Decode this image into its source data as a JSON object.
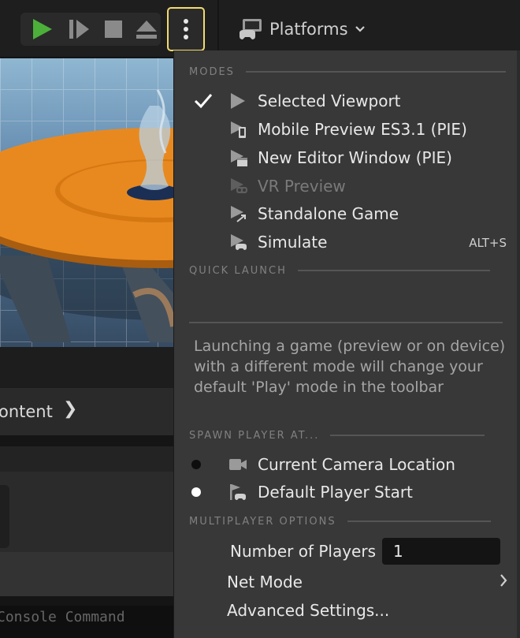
{
  "toolbar": {
    "platforms_label": "Platforms"
  },
  "background": {
    "content_label": "ontent",
    "console_placeholder": "Console Command"
  },
  "menu": {
    "modes_heading": "MODES",
    "modes": [
      {
        "label": "Selected Viewport",
        "icon": "play-triangle-icon",
        "checked": true,
        "enabled": true,
        "shortcut": ""
      },
      {
        "label": "Mobile Preview ES3.1 (PIE)",
        "icon": "mobile-preview-icon",
        "checked": false,
        "enabled": true,
        "shortcut": ""
      },
      {
        "label": "New Editor Window (PIE)",
        "icon": "new-window-icon",
        "checked": false,
        "enabled": true,
        "shortcut": ""
      },
      {
        "label": "VR Preview",
        "icon": "vr-headset-icon",
        "checked": false,
        "enabled": false,
        "shortcut": ""
      },
      {
        "label": "Standalone Game",
        "icon": "standalone-icon",
        "checked": false,
        "enabled": true,
        "shortcut": ""
      },
      {
        "label": "Simulate",
        "icon": "simulate-gamepad-icon",
        "checked": false,
        "enabled": true,
        "shortcut": "ALT+S"
      }
    ],
    "quick_launch_heading": "QUICK LAUNCH",
    "help_text": "Launching a game (preview or on device) with a different mode will change your default 'Play' mode in the toolbar",
    "spawn_heading": "SPAWN PLAYER AT...",
    "spawn_options": [
      {
        "label": "Current Camera Location",
        "icon": "camera-icon",
        "selected": false
      },
      {
        "label": "Default Player Start",
        "icon": "player-start-icon",
        "selected": true
      }
    ],
    "multiplayer_heading": "MULTIPLAYER OPTIONS",
    "number_of_players_label": "Number of Players",
    "number_of_players_value": "1",
    "net_mode_label": "Net Mode",
    "advanced_settings_label": "Advanced Settings..."
  },
  "colors": {
    "play_green": "#4caf3a",
    "highlight_yellow": "#f3da6d",
    "table_orange": "#e8891f"
  }
}
